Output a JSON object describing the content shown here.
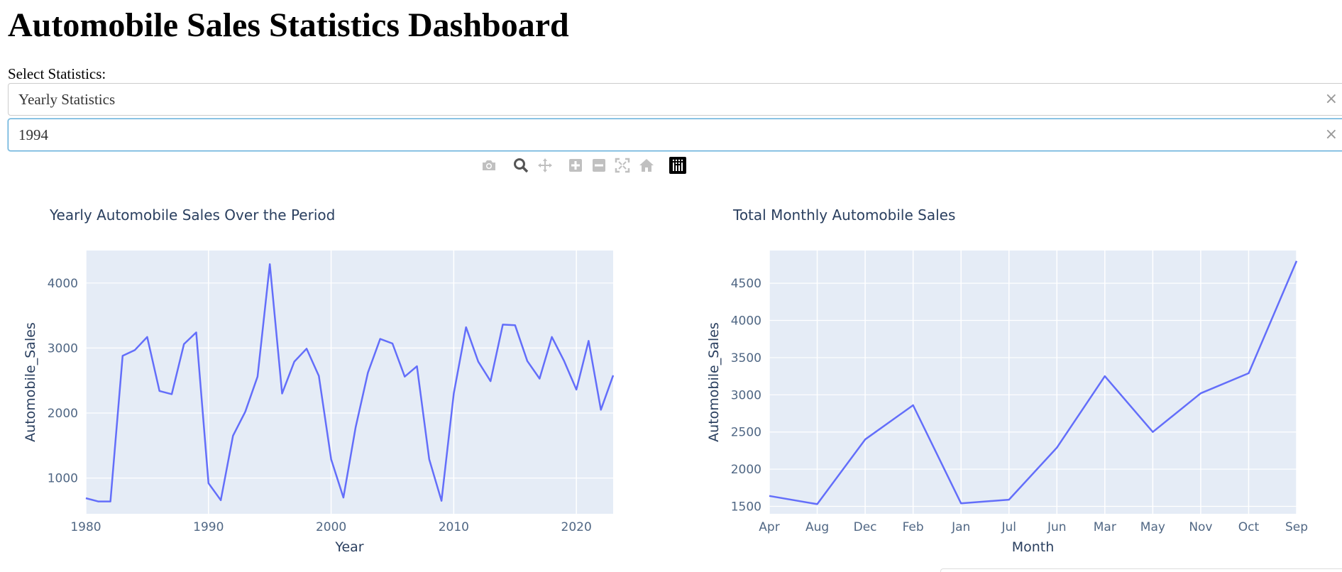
{
  "page": {
    "title": "Automobile Sales Statistics Dashboard",
    "select_label": "Select Statistics:"
  },
  "dropdowns": {
    "statistics": {
      "value": "Yearly Statistics",
      "clear": "×"
    },
    "year": {
      "value": "1994",
      "clear": "×"
    }
  },
  "modebar": {
    "buttons": [
      "camera-icon",
      "zoom-icon",
      "pan-icon",
      "zoom-in-icon",
      "zoom-out-icon",
      "autoscale-icon",
      "reset-axes-icon",
      "plotly-logo-icon"
    ]
  },
  "colors": {
    "line": "#636efa",
    "plot_bg": "#e5ecf6",
    "grid": "#ffffff",
    "text": "#2a3f5f",
    "tick_text": "#506784"
  },
  "chart_data": [
    {
      "type": "line",
      "title": "Yearly Automobile Sales Over the Period",
      "xlabel": "Year",
      "ylabel": "Automobile_Sales",
      "xlim": [
        1980,
        2023
      ],
      "ylim": [
        450,
        4500
      ],
      "xticks": [
        1980,
        1990,
        2000,
        2010,
        2020
      ],
      "yticks": [
        1000,
        2000,
        3000,
        4000
      ],
      "grid": true,
      "x": [
        1980,
        1981,
        1982,
        1983,
        1984,
        1985,
        1986,
        1987,
        1988,
        1989,
        1990,
        1991,
        1992,
        1993,
        1994,
        1995,
        1996,
        1997,
        1998,
        1999,
        2000,
        2001,
        2002,
        2003,
        2004,
        2005,
        2006,
        2007,
        2008,
        2009,
        2010,
        2011,
        2012,
        2013,
        2014,
        2015,
        2016,
        2017,
        2018,
        2019,
        2020,
        2021,
        2022,
        2023
      ],
      "y": [
        690,
        640,
        640,
        2880,
        2970,
        3170,
        2340,
        2290,
        3060,
        3240,
        920,
        660,
        1650,
        2020,
        2560,
        4290,
        2300,
        2790,
        2990,
        2570,
        1290,
        700,
        1780,
        2620,
        3140,
        3070,
        2560,
        2720,
        1290,
        650,
        2300,
        3320,
        2790,
        2490,
        3360,
        3350,
        2800,
        2530,
        3170,
        2800,
        2360,
        3110,
        2050,
        2580
      ]
    },
    {
      "type": "line",
      "title": "Total Monthly Automobile Sales",
      "xlabel": "Month",
      "ylabel": "Automobile_Sales",
      "categories": [
        "Apr",
        "Aug",
        "Dec",
        "Feb",
        "Jan",
        "Jul",
        "Jun",
        "Mar",
        "May",
        "Nov",
        "Oct",
        "Sep"
      ],
      "values": [
        1640,
        1530,
        2400,
        2860,
        1540,
        1590,
        2290,
        3250,
        2500,
        3020,
        3290,
        4800
      ],
      "ylim": [
        1400,
        4940
      ],
      "yticks": [
        1500,
        2000,
        2500,
        3000,
        3500,
        4000,
        4500
      ],
      "grid": true
    }
  ]
}
